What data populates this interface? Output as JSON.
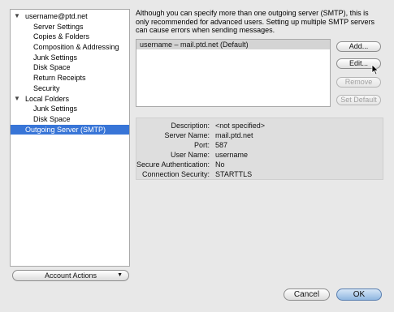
{
  "sidebar": {
    "items": [
      {
        "label": "username@ptd.net",
        "level": 0,
        "expanded": true
      },
      {
        "label": "Server Settings",
        "level": 1
      },
      {
        "label": "Copies & Folders",
        "level": 1
      },
      {
        "label": "Composition & Addressing",
        "level": 1
      },
      {
        "label": "Junk Settings",
        "level": 1
      },
      {
        "label": "Disk Space",
        "level": 1
      },
      {
        "label": "Return Receipts",
        "level": 1
      },
      {
        "label": "Security",
        "level": 1
      },
      {
        "label": "Local Folders",
        "level": 0,
        "expanded": true
      },
      {
        "label": "Junk Settings",
        "level": 1
      },
      {
        "label": "Disk Space",
        "level": 1
      },
      {
        "label": "Outgoing Server (SMTP)",
        "level": 0,
        "selected": true
      }
    ],
    "account_actions_label": "Account Actions"
  },
  "info_text": "Although you can specify more than one outgoing server (SMTP), this is only recommended for advanced users. Setting up multiple SMTP servers can cause errors when sending messages.",
  "server_list": {
    "rows": [
      "username – mail.ptd.net (Default)"
    ]
  },
  "buttons": {
    "add": "Add...",
    "edit": "Edit...",
    "remove": "Remove",
    "set_default": "Set Default"
  },
  "details": {
    "description_label": "Description:",
    "description_value": "<not specified>",
    "server_name_label": "Server Name:",
    "server_name_value": "mail.ptd.net",
    "port_label": "Port:",
    "port_value": "587",
    "user_name_label": "User Name:",
    "user_name_value": "username",
    "secure_auth_label": "Secure Authentication:",
    "secure_auth_value": "No",
    "connection_security_label": "Connection Security:",
    "connection_security_value": "STARTTLS"
  },
  "footer": {
    "cancel": "Cancel",
    "ok": "OK"
  },
  "colors": {
    "selection": "#3875d7",
    "list_selection": "#d4d4d4"
  }
}
